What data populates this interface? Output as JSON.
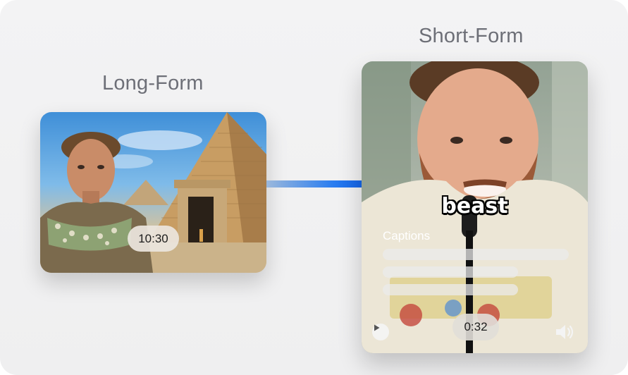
{
  "long_form": {
    "label": "Long-Form",
    "duration": "10:30"
  },
  "short_form": {
    "label": "Short-Form",
    "overlay_word": "beast",
    "captions_title": "Captions",
    "duration": "0:32",
    "play_icon": "play-icon",
    "volume_icon": "volume-icon"
  },
  "colors": {
    "background": "#f3f3f4",
    "label": "#6d6f77",
    "connector_accent": "#1565e8"
  }
}
